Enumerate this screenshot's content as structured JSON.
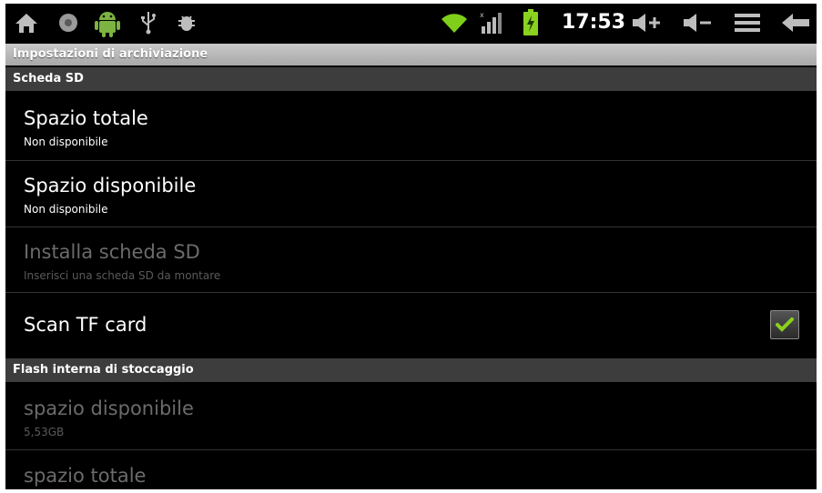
{
  "status_bar": {
    "time": "17:53",
    "icons_left": [
      "home-icon",
      "record-icon",
      "android-icon",
      "usb-icon",
      "debug-bug-icon"
    ],
    "icons_right": [
      "wifi-icon",
      "signal-icon",
      "battery-charging-icon",
      "volume-up-icon",
      "volume-down-icon",
      "menu-icon",
      "back-icon"
    ]
  },
  "title": "Impostazioni di archiviazione",
  "sections": [
    {
      "header": "Scheda SD",
      "items": [
        {
          "title": "Spazio totale",
          "summary": "Non disponibile",
          "enabled": true
        },
        {
          "title": "Spazio disponibile",
          "summary": "Non disponibile",
          "enabled": true
        },
        {
          "title": "Installa scheda SD",
          "summary": "Inserisci una scheda SD da montare",
          "enabled": false
        },
        {
          "title": "Scan TF card",
          "checked": true,
          "enabled": true
        }
      ]
    },
    {
      "header": "Flash interna di stoccaggio",
      "items": [
        {
          "title": "spazio disponibile",
          "summary": "5,53GB",
          "enabled": false
        },
        {
          "title": "spazio totale",
          "enabled": false
        }
      ]
    }
  ],
  "colors": {
    "accent_green": "#8bd11f",
    "wifi_green": "#7fcf1a"
  }
}
